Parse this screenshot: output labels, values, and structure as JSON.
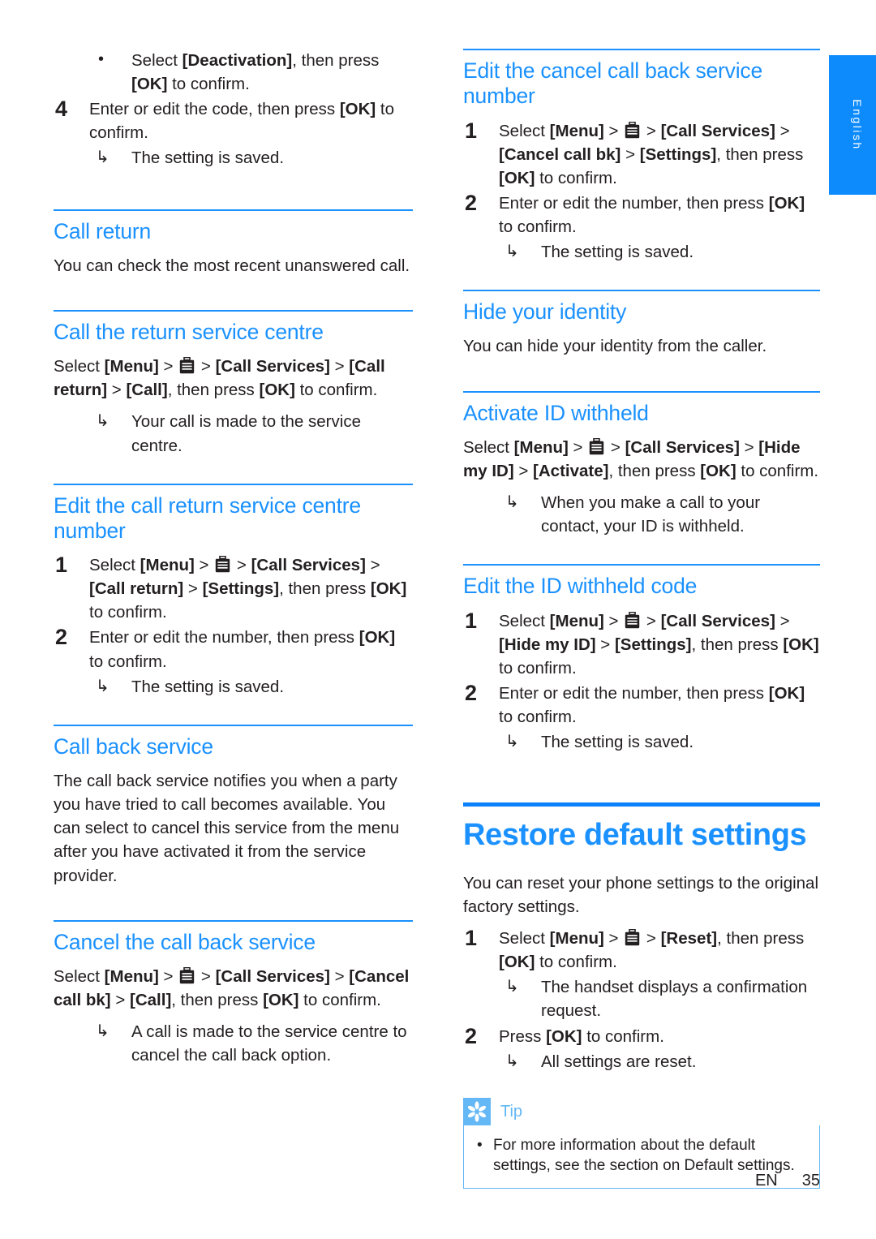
{
  "page": {
    "language_tab": "English",
    "footer_lang": "EN",
    "footer_page": "35",
    "accent_blue": "#1a91ff",
    "chapter_rule_blue": "#0b82fa",
    "tip_blue": "#63b8f5",
    "text_color": "#231f20"
  },
  "icons": {
    "services": "briefcase-icon",
    "arrow": "↳",
    "bullet": "•",
    "tip": "asterisk-flower-icon"
  },
  "left_column": {
    "continued_bullet": {
      "pre": "Select ",
      "bold1": "[Deactivation]",
      "mid": ", then press ",
      "bold2": "[OK]",
      "post": " to confirm."
    },
    "step4": {
      "num": "4",
      "text": "Enter or edit the code, then press [OK] to confirm.",
      "result": "The setting is saved."
    },
    "call_return": {
      "heading": "Call return",
      "body": "You can check the most recent unanswered call."
    },
    "call_return_service_centre": {
      "heading": "Call the return service centre",
      "instruction_parts": [
        "Select ",
        "[Menu]",
        " > ",
        "ICON",
        " > ",
        "[Call Services]",
        " > ",
        "[Call return]",
        " > ",
        "[Call]",
        ", then press ",
        "[OK]",
        " to confirm."
      ],
      "result": "Your call is made to the service centre."
    },
    "edit_call_return_number": {
      "heading": "Edit the call return service centre number",
      "step1": {
        "num": "1",
        "text": "Select [Menu] > ICON > [Call Services] > [Call return] > [Settings], then press [OK] to confirm."
      },
      "step2": {
        "num": "2",
        "text": "Enter or edit the number, then press [OK] to confirm.",
        "result": "The setting is saved."
      }
    },
    "call_back_service": {
      "heading": "Call back service",
      "body": "The call back service notifies you when a party you have tried to call becomes available. You can select to cancel this service from the menu after you have activated it from the service provider."
    },
    "cancel_call_back_service": {
      "heading": "Cancel the call back service",
      "instruction": "Select [Menu] > ICON > [Call Services] > [Cancel call bk] > [Call], then press [OK] to confirm.",
      "result": "A call is made to the service centre to cancel the call back option."
    }
  },
  "right_column": {
    "edit_cancel_call_back_number": {
      "heading": "Edit the cancel call back service number",
      "step1": {
        "num": "1",
        "text": "Select [Menu] > ICON > [Call Services] > [Cancel call bk] > [Settings], then press [OK] to confirm."
      },
      "step2": {
        "num": "2",
        "text": "Enter or edit the number, then press [OK] to confirm.",
        "result": "The setting is saved."
      }
    },
    "hide_your_identity": {
      "heading": "Hide your identity",
      "body": "You can hide your identity from the caller."
    },
    "activate_id_withheld": {
      "heading": "Activate ID withheld",
      "instruction": "Select [Menu] > ICON > [Call Services] > [Hide my ID] > [Activate], then press [OK] to confirm.",
      "result": "When you make a call to your contact, your ID is withheld."
    },
    "edit_id_withheld_code": {
      "heading": "Edit the ID withheld code",
      "step1": {
        "num": "1",
        "text": "Select [Menu] > ICON > [Call Services] > [Hide my ID] > [Settings], then press [OK] to confirm."
      },
      "step2": {
        "num": "2",
        "text": "Enter or edit the number, then press [OK] to confirm.",
        "result": "The setting is saved."
      }
    },
    "restore_default_settings": {
      "heading": "Restore default settings",
      "body": "You can reset your phone settings to the original factory settings.",
      "step1": {
        "num": "1",
        "text": "Select [Menu] > ICON > [Reset], then press [OK] to confirm.",
        "result": "The handset displays a confirmation request."
      },
      "step2": {
        "num": "2",
        "text": "Press [OK] to confirm.",
        "result": "All settings are reset."
      },
      "tip": {
        "label": "Tip",
        "bullet": "For more information about the default settings, see the section on Default settings."
      }
    }
  }
}
